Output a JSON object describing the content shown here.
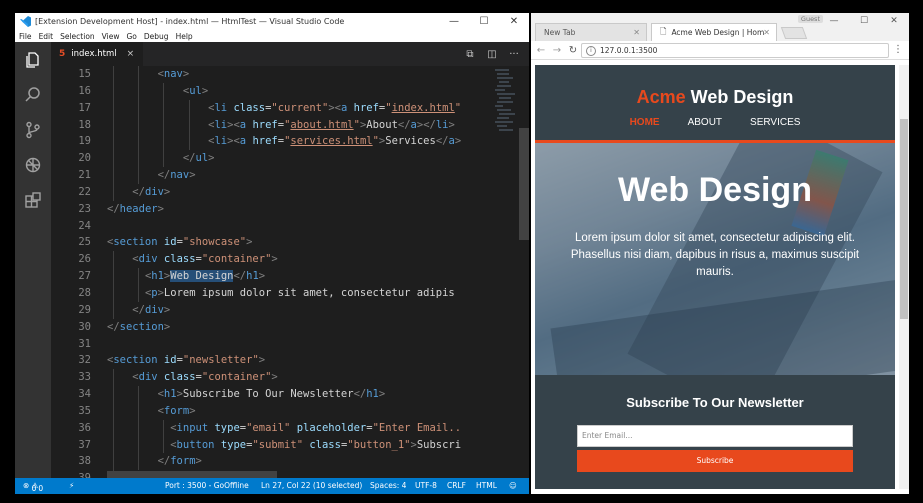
{
  "vscode": {
    "title": "[Extension Development Host] - index.html — HtmlTest — Visual Studio Code",
    "menu": [
      "File",
      "Edit",
      "Selection",
      "View",
      "Go",
      "Debug",
      "Help"
    ],
    "tab": {
      "label": "index.html",
      "close": "×"
    },
    "line_numbers": [
      "15",
      "16",
      "17",
      "18",
      "19",
      "20",
      "21",
      "22",
      "23",
      "24",
      "25",
      "26",
      "27",
      "28",
      "29",
      "30",
      "31",
      "32",
      "33",
      "34",
      "35",
      "36",
      "37",
      "38",
      "39"
    ],
    "status": {
      "errors": "0",
      "warnings": "0",
      "port": "Port : 3500 - GoOffline",
      "position": "Ln 27, Col 22 (10 selected)",
      "spaces": "Spaces: 4",
      "encoding": "UTF-8",
      "eol": "CRLF",
      "language": "HTML"
    }
  },
  "browser": {
    "tab1": "New Tab",
    "tab2": "Acme Web Design | Hom",
    "guest": "Guest",
    "url": "127.0.0.1:3500",
    "site": {
      "brand_highlight": "Acme",
      "brand_rest": " Web Design",
      "nav": [
        "Home",
        "About",
        "Services"
      ],
      "showcase_title": "Web Design",
      "showcase_text": "Lorem ipsum dolor sit amet, consectetur adipiscing elit. Phasellus nisi diam, dapibus in risus a, maximus suscipit mauris.",
      "newsletter_title": "Subscribe To Our Newsletter",
      "email_placeholder": "Enter Email...",
      "subscribe_label": "Subscribe"
    }
  },
  "colors": {
    "accent": "#e8491d",
    "header_bg": "#35424a",
    "statusbar": "#007acc"
  }
}
